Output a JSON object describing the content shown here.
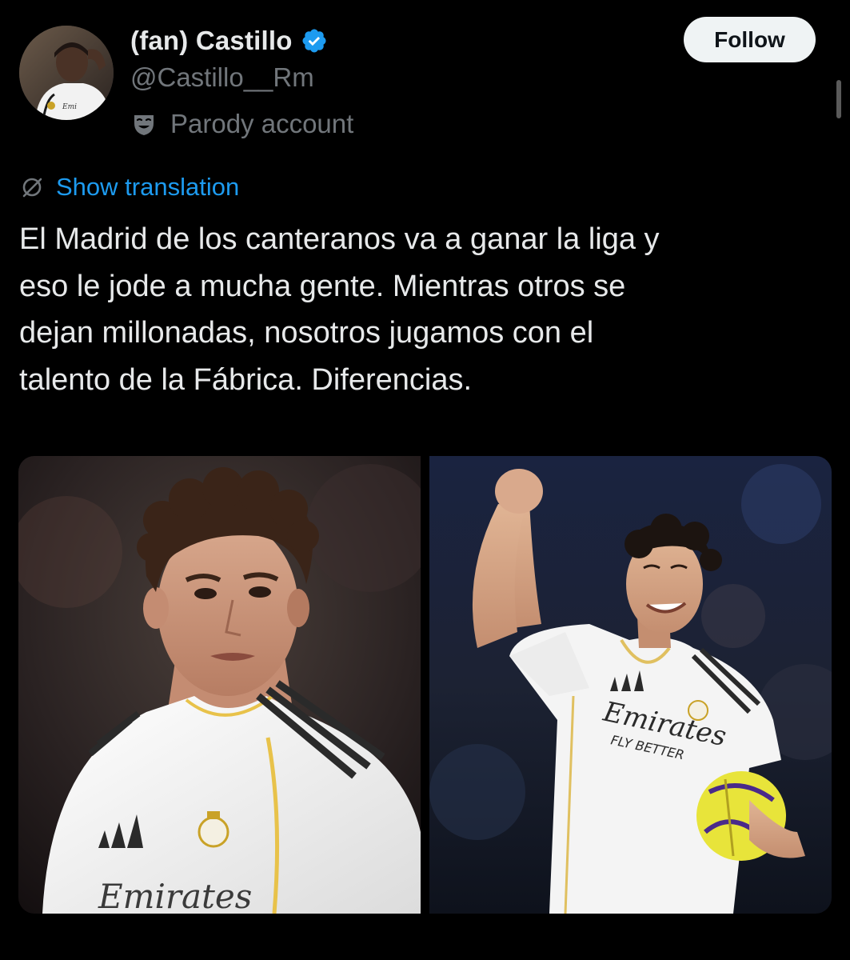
{
  "tweet": {
    "display_name": "(fan) Castillo",
    "handle": "@Castillo__Rm",
    "account_label": "Parody account",
    "follow_label": "Follow",
    "translation_label": "Show translation",
    "text": "El Madrid de los canteranos va a ganar la liga y\neso le jode a mucha gente. Mientras otros se\ndejan millonadas, nosotros jugamos con el\ntalento de la Fábrica. Diferencias.",
    "media": [
      {
        "kit_text": "Emirates"
      },
      {
        "kit_text": "Emirates",
        "kit_subtext": "FLY BETTER"
      }
    ]
  },
  "icons": {
    "verified": "verified-badge-icon",
    "parody": "theater-mask-icon",
    "translation": "translate-slash-icon"
  },
  "colors": {
    "background": "#000000",
    "primary_text": "#e7e9ea",
    "secondary_text": "#71767b",
    "link": "#1d9bf0",
    "verified_badge": "#1d9bf0",
    "follow_bg": "#eff3f4",
    "follow_text": "#0f1419"
  }
}
